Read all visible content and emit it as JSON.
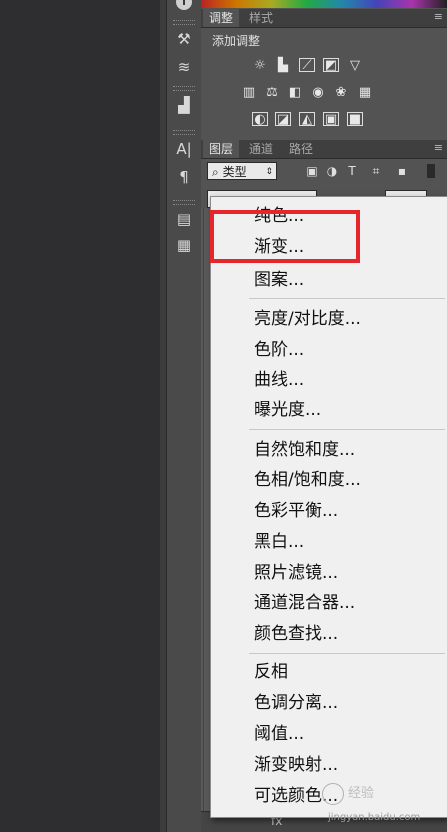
{
  "adjustments_panel": {
    "tabs": [
      "调整",
      "样式"
    ],
    "title": "添加调整"
  },
  "layers_panel": {
    "tabs": [
      "图层",
      "通道",
      "路径"
    ],
    "kind_filter": "类型",
    "filter_icons": [
      "image-icon",
      "circle-icon",
      "type-icon",
      "transform-icon",
      "lock-icon"
    ],
    "fx_label": "fx"
  },
  "menu": {
    "items_group1": [
      "纯色...",
      "渐变...",
      "图案..."
    ],
    "items_group2": [
      "亮度/对比度...",
      "色阶...",
      "曲线...",
      "曝光度..."
    ],
    "items_group3": [
      "自然饱和度...",
      "色相/饱和度...",
      "色彩平衡...",
      "黑白...",
      "照片滤镜...",
      "通道混合器...",
      "颜色查找..."
    ],
    "items_group4": [
      "反相",
      "色调分离...",
      "阈值...",
      "渐变映射...",
      "可选颜色..."
    ]
  },
  "highlight_color": "#e5272d",
  "watermark": {
    "text": "经验",
    "url": "jingyan.baidu.com"
  }
}
